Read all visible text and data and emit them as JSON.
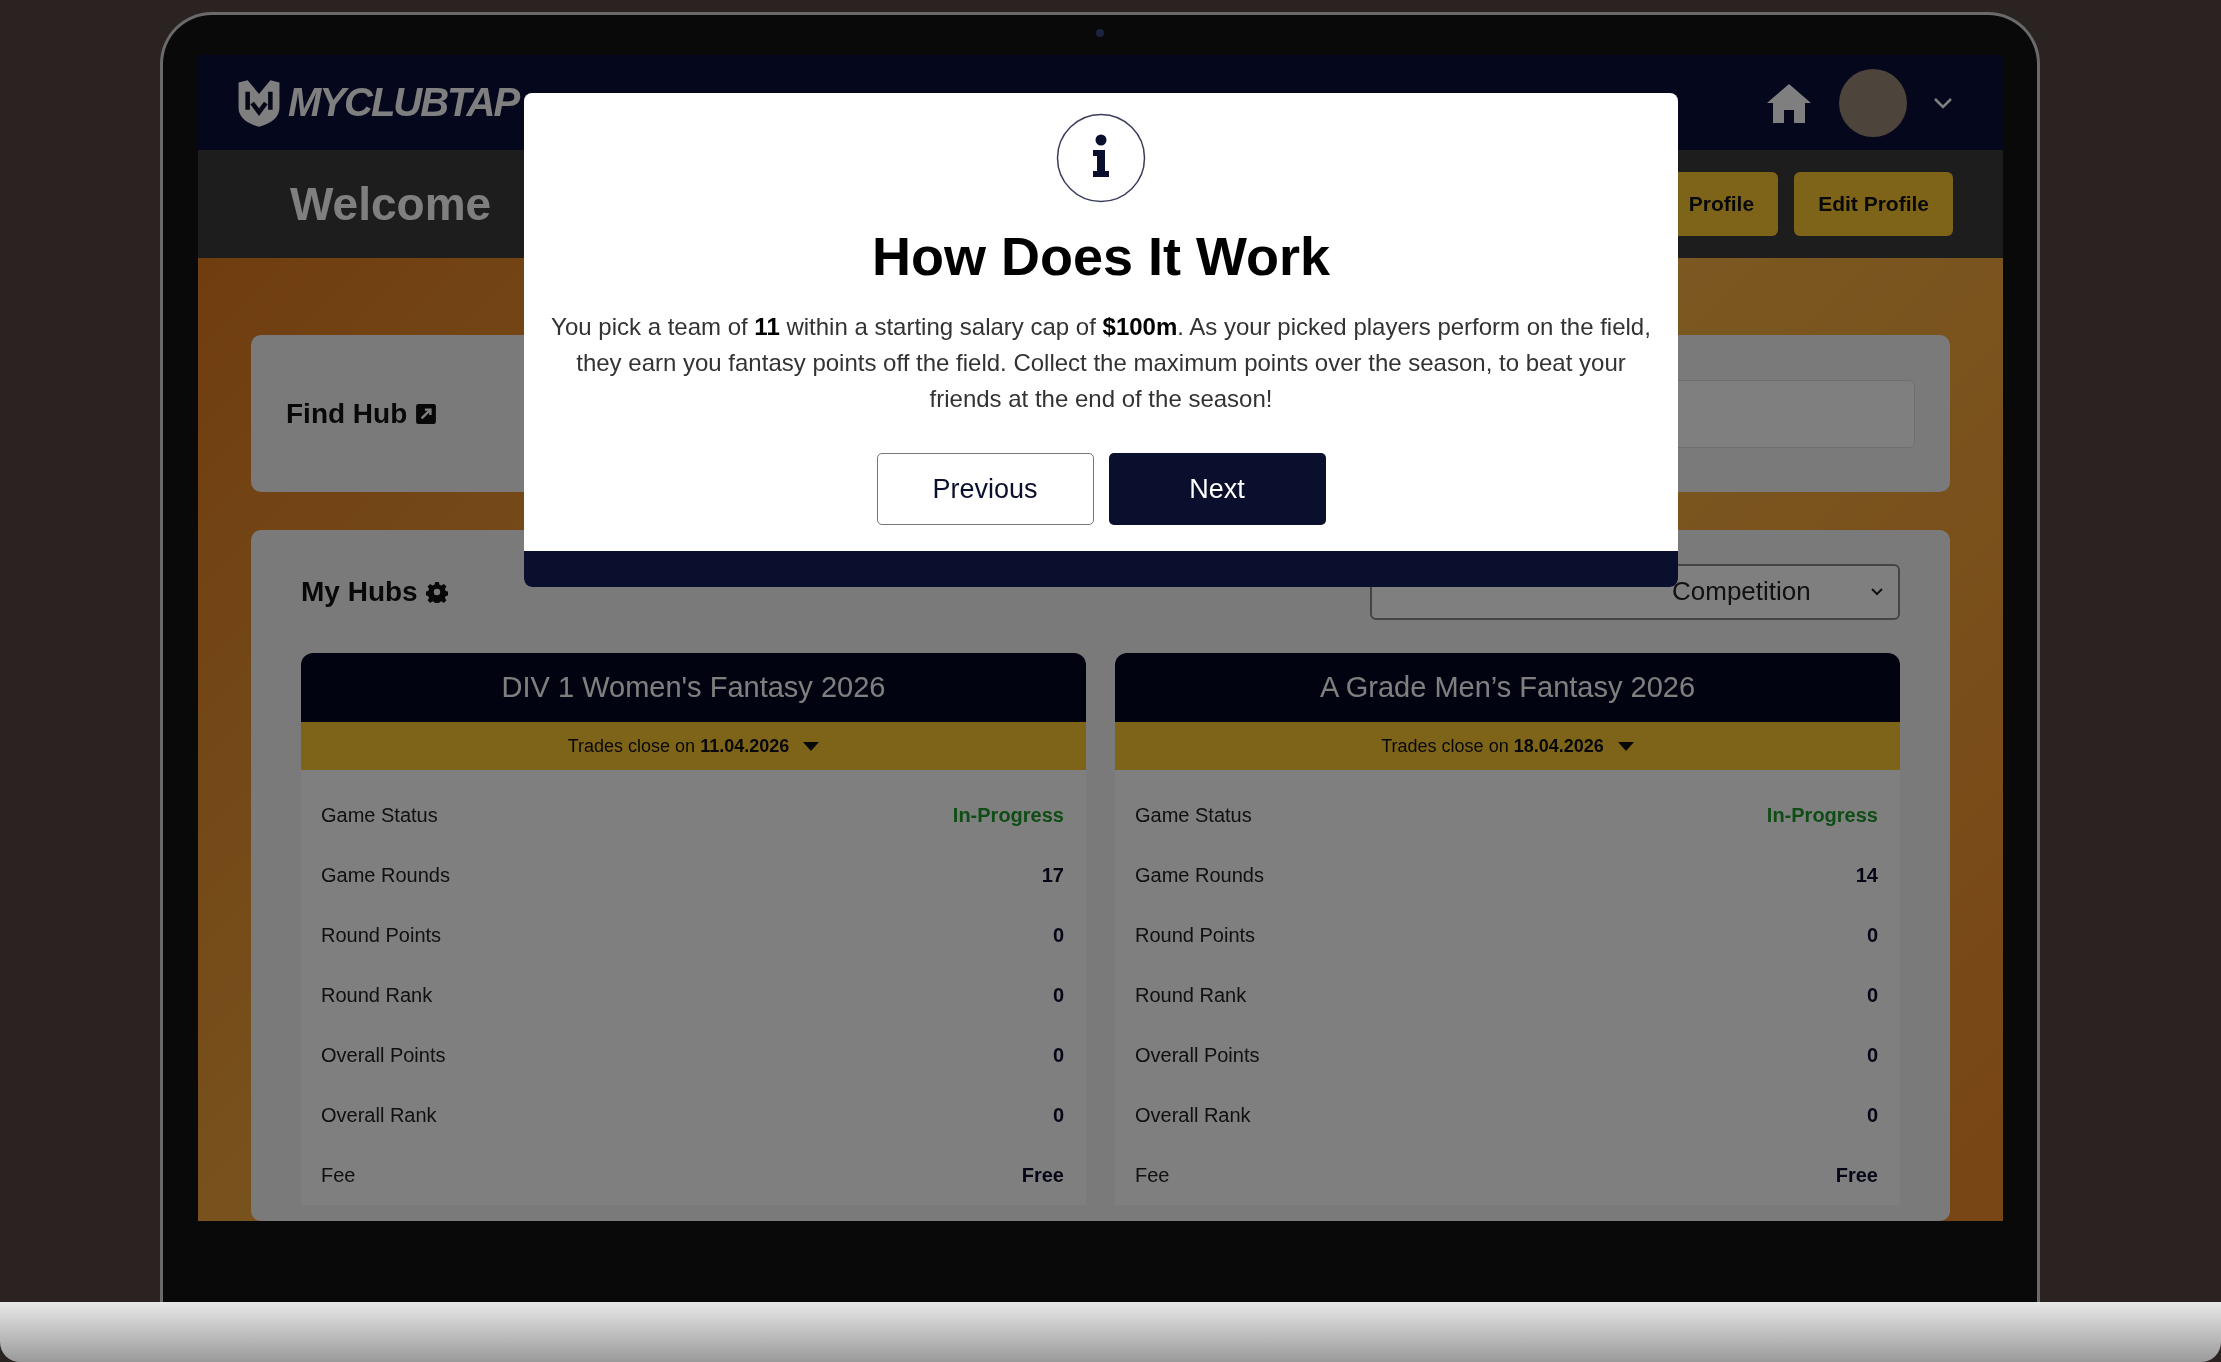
{
  "header": {
    "logo": "MYCLUBTAP"
  },
  "welcome": {
    "title": "Welcome",
    "buttons": [
      "Profile",
      "Edit Profile"
    ]
  },
  "find_hub": {
    "label": "Find Hub"
  },
  "my_hubs": {
    "label": "My Hubs",
    "filter": "Competition",
    "hubs": [
      {
        "title": "DIV 1 Women's Fantasy 2026",
        "trades": "Trades close on **11.04.2026**",
        "stats": [
          {
            "label": "Game Status",
            "value": "In-Progress",
            "kind": "status"
          },
          {
            "label": "Game Rounds",
            "value": "17",
            "kind": "number"
          },
          {
            "label": "Round Points",
            "value": "0",
            "kind": "number"
          },
          {
            "label": "Round Rank",
            "value": "0",
            "kind": "number"
          },
          {
            "label": "Overall Points",
            "value": "0",
            "kind": "number"
          },
          {
            "label": "Overall Rank",
            "value": "0",
            "kind": "number"
          },
          {
            "label": "Fee",
            "value": "Free",
            "kind": "number"
          }
        ]
      },
      {
        "title": "A Grade Men’s Fantasy 2026",
        "trades": "Trades close on **18.04.2026**",
        "stats": [
          {
            "label": "Game Status",
            "value": "In-Progress",
            "kind": "status"
          },
          {
            "label": "Game Rounds",
            "value": "14",
            "kind": "number"
          },
          {
            "label": "Round Points",
            "value": "0",
            "kind": "number"
          },
          {
            "label": "Round Rank",
            "value": "0",
            "kind": "number"
          },
          {
            "label": "Overall Points",
            "value": "0",
            "kind": "number"
          },
          {
            "label": "Overall Rank",
            "value": "0",
            "kind": "number"
          },
          {
            "label": "Fee",
            "value": "Free",
            "kind": "number"
          }
        ]
      }
    ]
  },
  "modal": {
    "title": "How Does It Work",
    "body": "You pick a team of **11** within a starting salary cap of **$100m**. As your picked players perform on the field, they earn you fantasy points off the field. Collect the maximum points over the season, to beat your friends at the end of the season!",
    "buttons": [
      {
        "label": "Previous",
        "kind": "secondary"
      },
      {
        "label": "Next",
        "kind": "primary"
      }
    ]
  }
}
